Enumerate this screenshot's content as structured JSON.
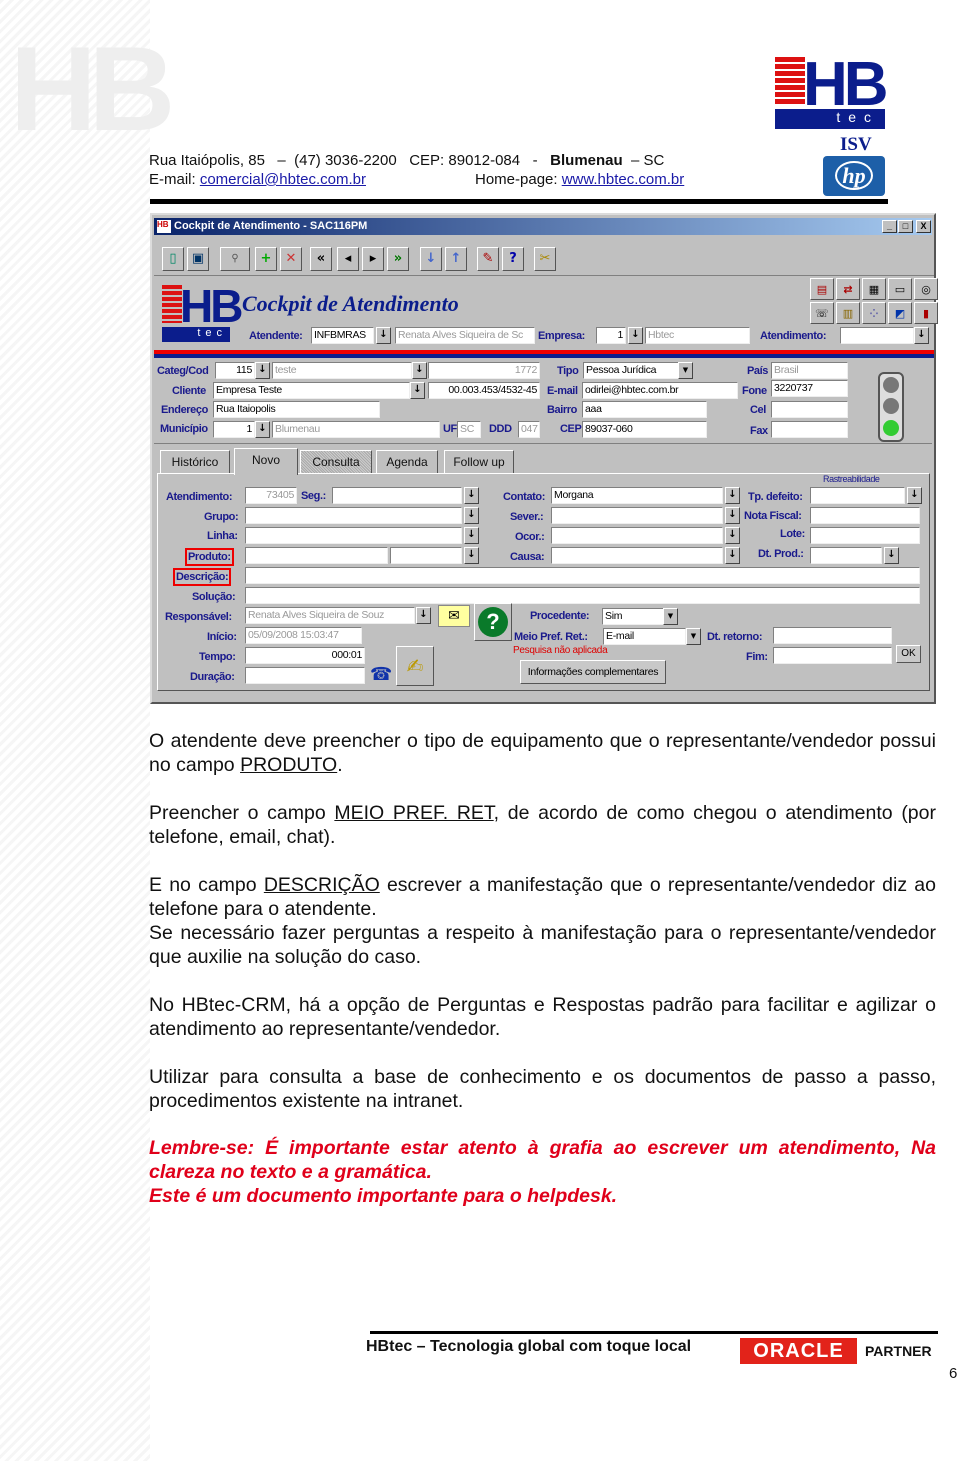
{
  "letterhead": {
    "address": "Rua Itaiópolis, 85",
    "dash": "–",
    "phone": "(47) 3036-2200",
    "cep": "CEP: 89012-084",
    "sep": "-",
    "city": "Blumenau",
    "state": "– SC",
    "email_label": "E-mail:",
    "email": "comercial@hbtec.com.br",
    "homepage_label": "Home-page:",
    "homepage": "www.hbtec.com.br",
    "logo_text": "HB tec",
    "isv": "ISV",
    "hp_logo": "hp"
  },
  "app": {
    "window_title": "Cockpit de Atendimento - SAC116PM",
    "window_controls": [
      "_",
      "□",
      "X"
    ],
    "header_title": "Cockpit de Atendimento",
    "logo_text": "tec",
    "toolbar_icons": [
      "exit-icon",
      "save-icon",
      "query-icon",
      "add-icon",
      "delete-icon",
      "first-icon",
      "previous-icon",
      "next-icon",
      "last-icon",
      "down-icon",
      "up-icon",
      "edit-icon",
      "help-icon",
      "tools-icon"
    ],
    "atendente_label": "Atendente:",
    "atendente_code": "INFBMRAS",
    "atendente_name": "Renata Alves Siqueira de Sc",
    "empresa_label": "Empresa:",
    "empresa_code": "1",
    "empresa_name": "Hbtec",
    "atendimento_label": "Atendimento:",
    "atendimento_value": "",
    "customer": {
      "categ_label": "Categ/Cod",
      "categ_code": "115",
      "categ_name": "teste",
      "categ_num": "1772",
      "tipo_label": "Tipo",
      "tipo_value": "Pessoa Jurídica",
      "pais_label": "País",
      "pais_value": "Brasil",
      "cliente_label": "Cliente",
      "cliente_value": "Empresa Teste",
      "cnpj": "00.003.453/4532-45",
      "email_label": "E-mail",
      "email_value": "odirlei@hbtec.com.br",
      "fone_label": "Fone",
      "fone_value": "3220737",
      "endereco_label": "Endereço",
      "endereco_value": "Rua Itaiopolis",
      "bairro_label": "Bairro",
      "bairro_value": "aaa",
      "cel_label": "Cel",
      "cel_value": "",
      "municipio_label": "Município",
      "municipio_code": "1",
      "municipio_name": "Blumenau",
      "uf_label": "UF",
      "uf_value": "SC",
      "ddd_label": "DDD",
      "ddd_value": "047",
      "cep_label": "CEP",
      "cep_value": "89037-060",
      "fax_label": "Fax",
      "fax_value": ""
    },
    "tabs": [
      {
        "label": "Histórico"
      },
      {
        "label": "Novo"
      },
      {
        "label": "Consulta"
      },
      {
        "label": "Agenda"
      },
      {
        "label": "Follow up"
      }
    ],
    "active_tab": "Novo",
    "form": {
      "rastreabilidade": "Rastreabilidade",
      "atendimento_label": "Atendimento:",
      "atendimento_value": "73405",
      "seg_label": "Seg.:",
      "grupo_label": "Grupo:",
      "linha_label": "Linha:",
      "produto_label": "Produto:",
      "descricao_label": "Descrição:",
      "solucao_label": "Solução:",
      "responsavel_label": "Responsável:",
      "responsavel_value": "Renata Alves Siqueira de Souz",
      "inicio_label": "Início:",
      "inicio_value": "05/09/2008 15:03:47",
      "tempo_label": "Tempo:",
      "tempo_value": "000:01",
      "duracao_label": "Duração:",
      "contato_label": "Contato:",
      "contato_value": "Morgana",
      "sever_label": "Sever.:",
      "ocor_label": "Ocor.:",
      "causa_label": "Causa:",
      "procedente_label": "Procedente:",
      "procedente_value": "Sim",
      "meio_label": "Meio Pref. Ret.:",
      "meio_value": "E-mail",
      "pesquisa_note": "Pesquisa não aplicada",
      "info_button": "Informações complementares",
      "tp_defeito_label": "Tp. defeito:",
      "nota_fiscal_label": "Nota Fiscal:",
      "lote_label": "Lote:",
      "dt_prod_label": "Dt. Prod.:",
      "dt_retorno_label": "Dt. retorno:",
      "fim_label": "Fim:",
      "ok_button": "OK"
    },
    "highlight_color": "#e00000"
  },
  "content": {
    "p1a": "O atendente deve preencher o tipo de equipamento que o representante/vendedor possui no campo ",
    "p1u": "PRODUTO",
    "p1b": ".",
    "p2a": "Preencher o campo ",
    "p2u": "MEIO PREF. RET",
    "p2b": ", de acordo de como chegou o atendimento (por telefone, email, chat).",
    "p3a": "E no campo ",
    "p3u": "DESCRIÇÃO",
    "p3b": " escrever a manifestação que o representante/vendedor diz ao telefone para o atendente.",
    "p4": "Se necessário fazer perguntas a respeito à manifestação para o representante/vendedor que auxilie na solução do caso.",
    "p5": "No HBtec-CRM, há a opção de Perguntas e Respostas padrão para facilitar e agilizar o atendimento ao representante/vendedor.",
    "p6": "Utilizar para consulta a base de conhecimento e os documentos de passo a passo, procedimentos existente na intranet.",
    "p7": "Lembre-se: É importante estar atento à grafia ao escrever um atendimento, Na clareza no texto e a gramática.",
    "p8": "Este é um documento importante para o helpdesk."
  },
  "footer": {
    "tagline": "HBtec – Tecnologia global com toque local",
    "oracle": "ORACLE",
    "partner": "PARTNER",
    "page_number": "6"
  }
}
